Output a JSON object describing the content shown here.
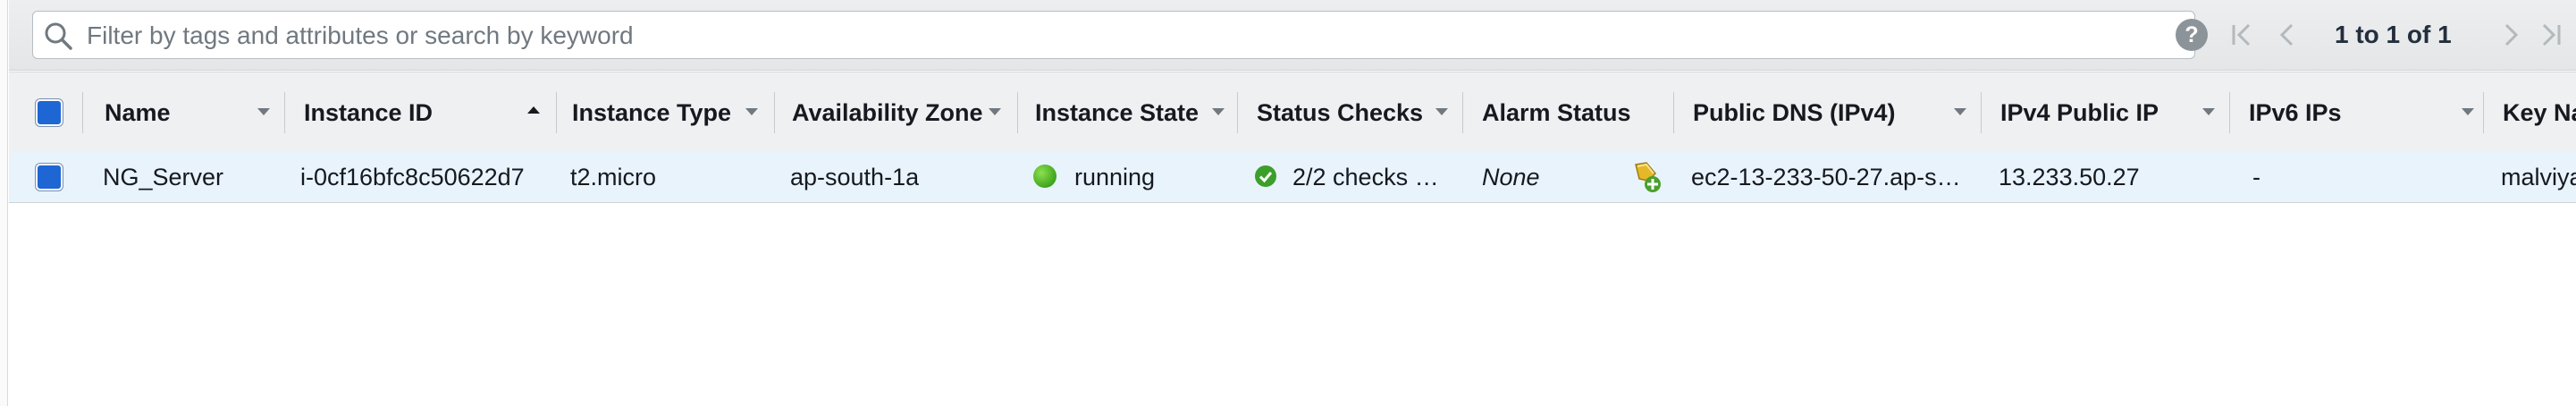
{
  "search": {
    "placeholder": "Filter by tags and attributes or search by keyword",
    "value": ""
  },
  "pagination": {
    "range": "1 to 1 of 1"
  },
  "columns": [
    {
      "label": "Name"
    },
    {
      "label": "Instance ID"
    },
    {
      "label": "Instance Type"
    },
    {
      "label": "Availability Zone"
    },
    {
      "label": "Instance State"
    },
    {
      "label": "Status Checks"
    },
    {
      "label": "Alarm Status"
    },
    {
      "label": "Public DNS (IPv4)"
    },
    {
      "label": "IPv4 Public IP"
    },
    {
      "label": "IPv6 IPs"
    },
    {
      "label": "Key Na"
    }
  ],
  "rows": [
    {
      "name": "NG_Server",
      "instance_id": "i-0cf16bfc8c50622d7",
      "instance_type": "t2.micro",
      "availability_zone": "ap-south-1a",
      "instance_state": "running",
      "status_checks": "2/2 checks …",
      "alarm_status": "None",
      "public_dns": "ec2-13-233-50-27.ap-s…",
      "ipv4_public_ip": "13.233.50.27",
      "ipv6_ips": "-",
      "key_name": "malviya"
    }
  ],
  "colors": {
    "checkbox": "#1e66d4",
    "row_selected": "#e8f3fc",
    "running": "#3fa51c",
    "check_ok": "#3b9f2a"
  },
  "icons": {
    "search": "search-icon",
    "help": "help-icon",
    "first_page": "first-page-icon",
    "prev_page": "prev-page-icon",
    "next_page": "next-page-icon",
    "last_page": "last-page-icon",
    "alarm": "create-alarm-icon"
  }
}
